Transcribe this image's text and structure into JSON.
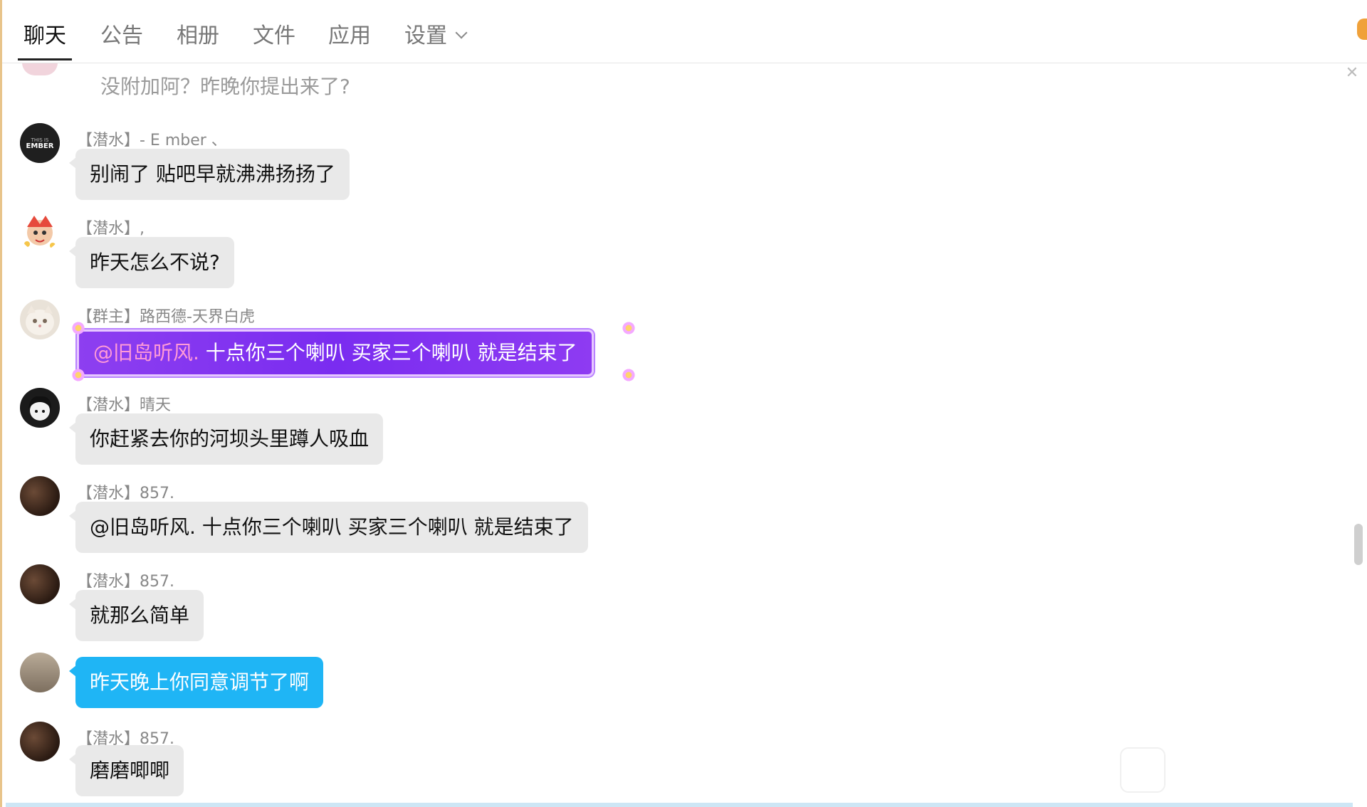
{
  "tabs": [
    {
      "label": "聊天",
      "active": true
    },
    {
      "label": "公告"
    },
    {
      "label": "相册"
    },
    {
      "label": "文件"
    },
    {
      "label": "应用"
    },
    {
      "label": "设置"
    }
  ],
  "chat": {
    "previous_message": "没附加阿？昨晚你提出来了?",
    "messages": [
      {
        "sender": "【潜水】- E mber 、",
        "text": "别闹了 贴吧早就沸沸扬扬了"
      },
      {
        "sender": "【潜水】,",
        "text": "昨天怎么不说?"
      },
      {
        "sender": "【群主】路西德-天界白虎",
        "mention": "@旧岛听风.",
        "text": " 十点你三个喇叭   买家三个喇叭  就是结束了"
      },
      {
        "sender": "【潜水】晴天",
        "text": "你赶紧去你的河坝头里蹲人吸血"
      },
      {
        "sender": "【潜水】857.",
        "text": "@旧岛听风. 十点你三个喇叭   买家三个喇叭  就是结束了"
      },
      {
        "sender": "【潜水】857.",
        "text": "就那么简单"
      },
      {
        "sender": "",
        "text": "昨天晚上你同意调节了啊"
      },
      {
        "sender": "【潜水】857.",
        "text": "磨磨唧唧"
      }
    ]
  },
  "colors": {
    "self_bubble": "#1fb5f5",
    "other_bubble": "#e9e9e9",
    "owner_bubble": "#7a2cf0"
  },
  "icons": {
    "settings_dropdown": "chevron-down-icon",
    "close": "close-icon"
  }
}
